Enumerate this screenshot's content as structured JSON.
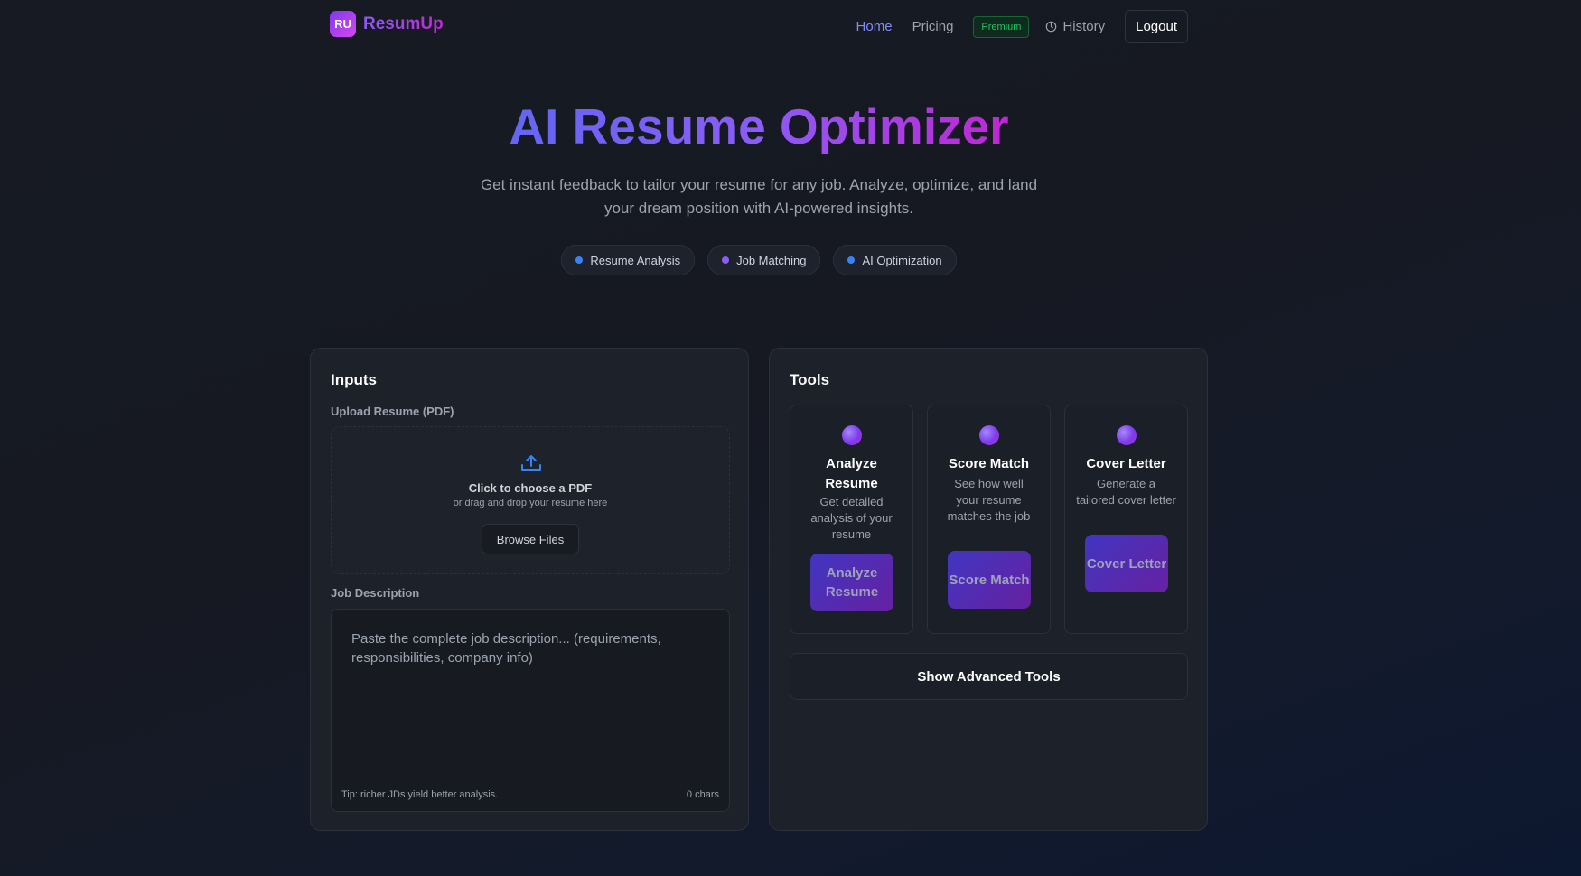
{
  "brand": {
    "logo_text": "RU",
    "name": "ResumUp"
  },
  "nav": {
    "home": "Home",
    "pricing": "Pricing",
    "premium_badge": "Premium",
    "history": "History",
    "logout": "Logout"
  },
  "hero": {
    "title": "AI Resume Optimizer",
    "subtitle": "Get instant feedback to tailor your resume for any job. Analyze, optimize, and land your dream position with AI-powered insights.",
    "pills": [
      {
        "label": "Resume Analysis",
        "dot_color": "#3b82f6"
      },
      {
        "label": "Job Matching",
        "dot_color": "#8b5cf6"
      },
      {
        "label": "AI Optimization",
        "dot_color": "#3b82f6"
      }
    ]
  },
  "inputs": {
    "title": "Inputs",
    "upload_label": "Upload Resume (PDF)",
    "dropzone_title": "Click to choose a PDF",
    "dropzone_sub": "or drag and drop your resume here",
    "browse_label": "Browse Files",
    "jd_label": "Job Description",
    "jd_placeholder": "Paste the complete job description... (requirements, responsibilities, company info)",
    "jd_value": "",
    "jd_tip": "Tip: richer JDs yield better analysis.",
    "jd_count": "0 chars"
  },
  "tools": {
    "title": "Tools",
    "cards": [
      {
        "name": "Analyze Resume",
        "desc": "Get detailed analysis of your resume",
        "button": "Analyze Resume"
      },
      {
        "name": "Score Match",
        "desc": "See how well your resume matches the job",
        "button": "Score Match"
      },
      {
        "name": "Cover Letter",
        "desc": "Generate a tailored cover letter",
        "button": "Cover Letter"
      }
    ],
    "advanced_label": "Show Advanced Tools"
  },
  "icons": {
    "history": "clock-icon",
    "upload": "upload-icon",
    "tool_orb": "gradient-orb-icon"
  },
  "colors": {
    "accent": "#8b5cf6",
    "accent_pink": "#c026d3",
    "premium_green": "#22c55e",
    "background": "#161922"
  }
}
